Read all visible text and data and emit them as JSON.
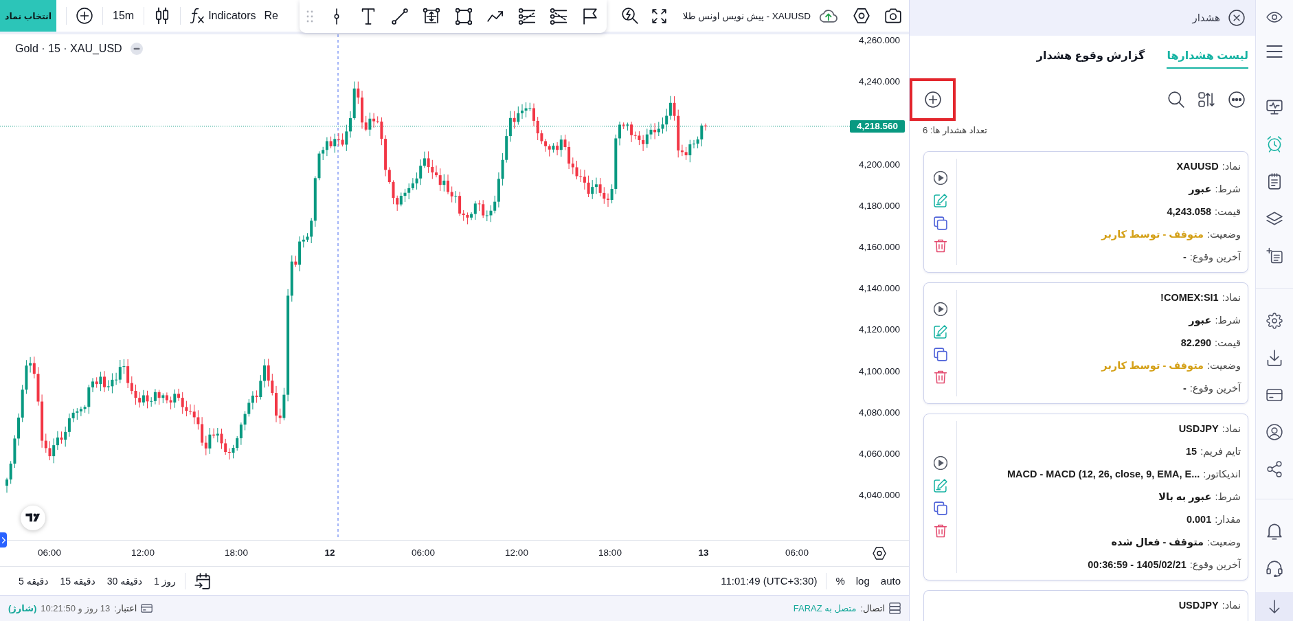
{
  "toolbar": {
    "symbol_button": "انتخاب نماد",
    "interval": "15m",
    "indicators": "Indicators",
    "partial_item": "Re",
    "title": "XAUUSD - پیش نویس اونس طلا"
  },
  "chart": {
    "legend": "Gold · 15 · XAU_USD",
    "price_labels": [
      "4,260.000",
      "4,240.000",
      "4,200.000",
      "4,180.000",
      "4,160.000",
      "4,140.000",
      "4,120.000",
      "4,100.000",
      "4,080.000",
      "4,060.000",
      "4,040.000"
    ],
    "last_price": "4,218.560",
    "time_labels": [
      {
        "text": "06:00",
        "kind": "time"
      },
      {
        "text": "13",
        "kind": "day"
      },
      {
        "text": "18:00",
        "kind": "time"
      },
      {
        "text": "12:00",
        "kind": "time"
      },
      {
        "text": "06:00",
        "kind": "time"
      },
      {
        "text": "12",
        "kind": "day"
      },
      {
        "text": "18:00",
        "kind": "time"
      },
      {
        "text": "12:00",
        "kind": "time"
      },
      {
        "text": "06:00",
        "kind": "time"
      }
    ]
  },
  "bottom_toolbar": {
    "scale_options": [
      "auto",
      "log",
      "%"
    ],
    "clock": "11:01:49 (UTC+3:30)",
    "ranges": [
      "1 روز",
      "30 دقیقه",
      "15 دقیقه",
      "5 دقیقه"
    ]
  },
  "status_bar": {
    "connection": {
      "label": "اتصال:",
      "value": "متصل به FARAZ"
    },
    "credit": {
      "label": "اعتبار:",
      "value": "13 روز و 10:21:50",
      "action": "(شارژ)"
    }
  },
  "alerts_panel": {
    "title": "هشدار",
    "tabs": [
      {
        "label": "لیست هشدارها",
        "selected": true
      },
      {
        "label": "گزارش وقوع هشدار",
        "selected": false
      }
    ],
    "count": "تعداد هشدار ها: 6",
    "cards": [
      {
        "fields": [
          {
            "kind": "symbol",
            "label": "نماد:",
            "value": "XAUUSD"
          },
          {
            "kind": "condition",
            "label": "شرط:",
            "value": "عبور"
          },
          {
            "kind": "price",
            "label": "قیمت:",
            "value": "4,243.058"
          },
          {
            "kind": "status",
            "label": "وضعیت:",
            "value": "متوقف - توسط کاربر",
            "color": "#d4a017"
          },
          {
            "kind": "last",
            "label": "آخرین وقوع:",
            "value": "-"
          }
        ],
        "actions": [
          {
            "kind": "play"
          },
          {
            "kind": "edit"
          },
          {
            "kind": "copy"
          },
          {
            "kind": "delete"
          }
        ]
      },
      {
        "fields": [
          {
            "kind": "symbol",
            "label": "نماد:",
            "value": "COMEX:SI1!"
          },
          {
            "kind": "condition",
            "label": "شرط:",
            "value": "عبور"
          },
          {
            "kind": "price",
            "label": "قیمت:",
            "value": "82.290"
          },
          {
            "kind": "status",
            "label": "وضعیت:",
            "value": "متوقف - توسط کاربر",
            "color": "#d4a017"
          },
          {
            "kind": "last",
            "label": "آخرین وقوع:",
            "value": "-"
          }
        ],
        "actions": [
          {
            "kind": "play"
          },
          {
            "kind": "edit"
          },
          {
            "kind": "copy"
          },
          {
            "kind": "delete"
          }
        ]
      },
      {
        "fields": [
          {
            "kind": "symbol",
            "label": "نماد:",
            "value": "USDJPY"
          },
          {
            "kind": "timeframe",
            "label": "تایم فریم:",
            "value": "15"
          },
          {
            "kind": "indicator",
            "label": "اندیکاتور:",
            "value": "MACD - MACD (12, 26, close, 9, EMA, E..."
          },
          {
            "kind": "condition",
            "label": "شرط:",
            "value": "عبور به بالا"
          },
          {
            "kind": "amount",
            "label": "مقدار:",
            "value": "0.001"
          },
          {
            "kind": "status",
            "label": "وضعیت:",
            "value": "متوقف - فعال شده",
            "color": "#1a1a1a"
          },
          {
            "kind": "last",
            "label": "آخرین وقوع:",
            "value": "1405/02/21 - 00:36:59"
          }
        ],
        "actions": [
          {
            "kind": "play"
          },
          {
            "kind": "edit"
          },
          {
            "kind": "copy"
          },
          {
            "kind": "delete"
          }
        ]
      },
      {
        "fields": [
          {
            "kind": "symbol",
            "label": "نماد:",
            "value": "USDJPY"
          }
        ]
      }
    ]
  },
  "sidebar": {
    "groups": [
      {
        "items": [
          {
            "kind": "watch",
            "selected": false
          },
          {
            "kind": "menu",
            "selected": false
          }
        ]
      },
      {
        "items": [
          {
            "kind": "monitor",
            "selected": false
          },
          {
            "kind": "alerts",
            "selected": true
          },
          {
            "kind": "notes",
            "selected": false
          },
          {
            "kind": "layers",
            "selected": false
          },
          {
            "kind": "newlist",
            "selected": false
          }
        ]
      },
      {
        "items": [
          {
            "kind": "settings",
            "selected": false
          },
          {
            "kind": "download",
            "selected": false
          },
          {
            "kind": "billing",
            "selected": false
          },
          {
            "kind": "account",
            "selected": false
          },
          {
            "kind": "share",
            "selected": false
          }
        ]
      },
      {
        "items": [
          {
            "kind": "notifications",
            "selected": false
          },
          {
            "kind": "support",
            "selected": false
          }
        ]
      }
    ]
  }
}
